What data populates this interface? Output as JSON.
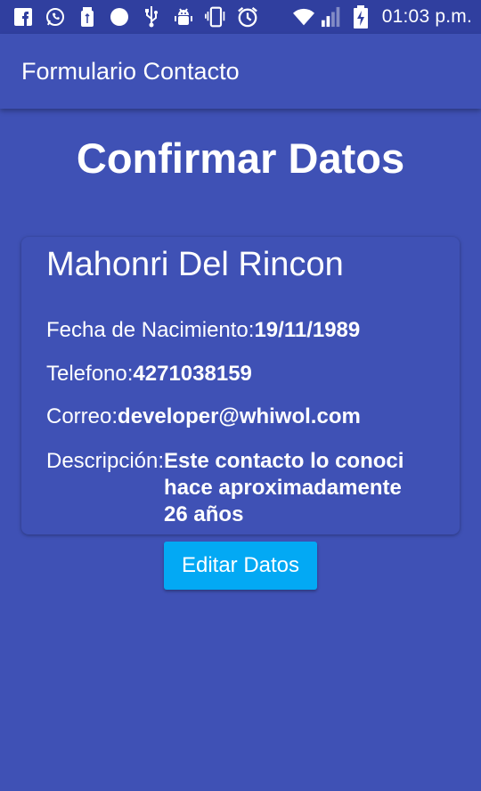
{
  "status_bar": {
    "time": "01:03 p.m.",
    "icons_left": [
      "facebook-icon",
      "whatsapp-icon",
      "usb-storage-icon",
      "circle-icon",
      "usb-icon",
      "android-debug-icon",
      "phone-vibrate-icon",
      "alarm-icon"
    ],
    "icons_right": [
      "wifi-icon",
      "signal-icon",
      "battery-charging-icon"
    ]
  },
  "app_bar": {
    "title": "Formulario Contacto"
  },
  "main": {
    "heading": "Confirmar Datos",
    "contact": {
      "name": "Mahonri Del Rincon",
      "fecha_label": "Fecha de Nacimiento:",
      "fecha_value": "19/11/1989",
      "telefono_label": "Telefono:",
      "telefono_value": "4271038159",
      "correo_label": "Correo:",
      "correo_value": "developer@whiwol.com",
      "descripcion_label": "Descripción:",
      "descripcion_value": "Este contacto lo conoci hace aproximadamente 26 años"
    },
    "edit_button_label": "Editar Datos"
  },
  "colors": {
    "primary": "#3F51B5",
    "primary_dark": "#303F9F",
    "accent": "#03A9F4",
    "text": "#FFFFFF"
  }
}
